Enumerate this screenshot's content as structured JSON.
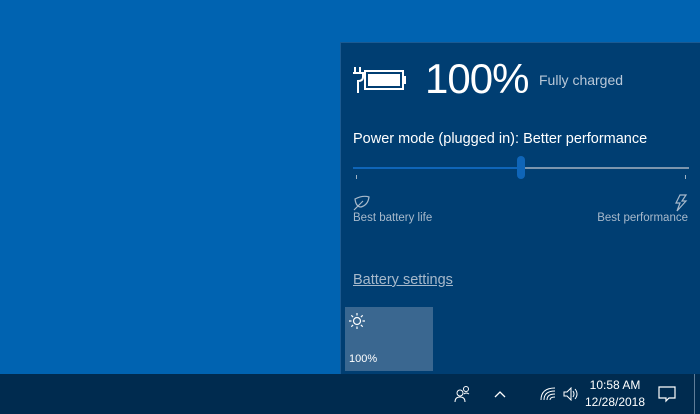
{
  "battery": {
    "percent": "100%",
    "status": "Fully charged",
    "level": 1.0
  },
  "power_mode": {
    "label": "Power mode (plugged in): Better performance",
    "slider_position": 0.5,
    "min_label": "Best battery life",
    "max_label": "Best performance"
  },
  "link": "Battery settings",
  "brightness_tile": {
    "value": "100%",
    "icon": "sun-icon"
  },
  "taskbar": {
    "time": "10:58 AM",
    "date": "12/28/2018"
  }
}
